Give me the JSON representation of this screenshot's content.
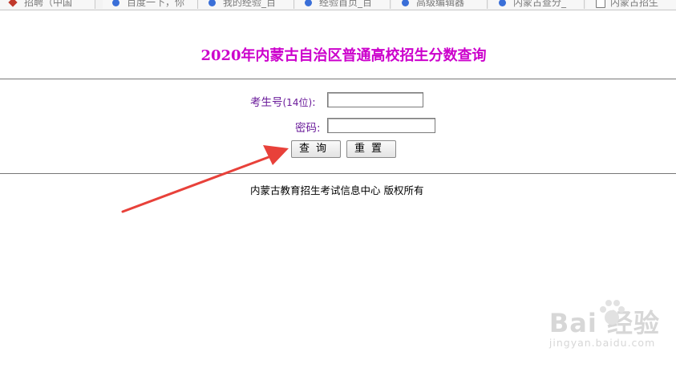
{
  "browser_tabs": [
    {
      "label": "招聘（中国",
      "icon": "site-logo-icon"
    },
    {
      "label": "百度一下，你",
      "icon": "baidu-paw-icon"
    },
    {
      "label": "我的经验_百",
      "icon": "baidu-paw-icon"
    },
    {
      "label": "经验首页_百",
      "icon": "baidu-paw-icon"
    },
    {
      "label": "高级编辑器",
      "icon": "baidu-paw-icon"
    },
    {
      "label": "内蒙古查分_",
      "icon": "baidu-paw-icon"
    },
    {
      "label": "内蒙古招生",
      "icon": "page-icon"
    }
  ],
  "page": {
    "title": "2020年内蒙古自治区普通高校招生分数查询"
  },
  "form": {
    "exam_id_label": "考生号",
    "exam_id_hint": "(14位)",
    "exam_id_colon": ":",
    "exam_id_value": "",
    "password_label": "密码:",
    "password_value": "",
    "query_button": "查询",
    "reset_button": "重置"
  },
  "footer": {
    "text": "内蒙古教育招生考试信息中心  版权所有"
  },
  "watermark": {
    "brand": "Bai  经验",
    "url": "jingyan.baidu.com"
  },
  "colors": {
    "title": "#cc00cc",
    "label": "#6a1b9a",
    "annotation_arrow": "#e8413a",
    "watermark": "#d7d7d7"
  }
}
